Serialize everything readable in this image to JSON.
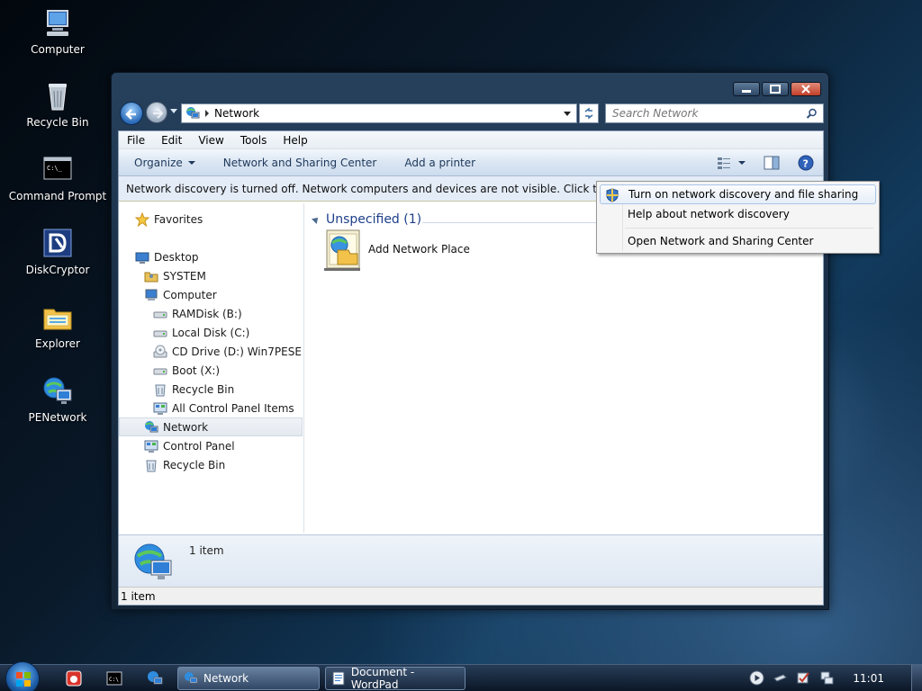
{
  "desktop": {
    "icons": [
      {
        "label": "Computer",
        "icon": "computer-icon"
      },
      {
        "label": "Recycle Bin",
        "icon": "recycle-bin-icon"
      },
      {
        "label": "Command Prompt",
        "icon": "command-prompt-icon"
      },
      {
        "label": "DiskCryptor",
        "icon": "diskcryptor-icon"
      },
      {
        "label": "Explorer",
        "icon": "explorer-icon"
      },
      {
        "label": "PENetwork",
        "icon": "penetwork-icon"
      }
    ]
  },
  "window": {
    "address": {
      "crumb": "Network"
    },
    "search": {
      "placeholder": "Search Network"
    },
    "menu": [
      "File",
      "Edit",
      "View",
      "Tools",
      "Help"
    ],
    "commands": {
      "organize": "Organize",
      "network_center": "Network and Sharing Center",
      "add_printer": "Add a printer"
    },
    "infobar": "Network discovery is turned off. Network computers and devices are not visible. Click to change...",
    "tree": [
      {
        "label": "Favorites",
        "icon": "star-icon"
      },
      {
        "label": "Desktop",
        "icon": "desktop-icon"
      },
      {
        "label": "SYSTEM",
        "icon": "user-folder-icon"
      },
      {
        "label": "Computer",
        "icon": "computer-icon"
      },
      {
        "label": "RAMDisk (B:)",
        "icon": "drive-icon"
      },
      {
        "label": "Local Disk (C:)",
        "icon": "drive-icon"
      },
      {
        "label": "CD Drive (D:) Win7PESE",
        "icon": "cd-drive-icon"
      },
      {
        "label": "Boot (X:)",
        "icon": "drive-icon"
      },
      {
        "label": "Recycle Bin",
        "icon": "recycle-bin-icon"
      },
      {
        "label": "All Control Panel Items",
        "icon": "control-panel-icon"
      },
      {
        "label": "Network",
        "icon": "network-icon"
      },
      {
        "label": "Control Panel",
        "icon": "control-panel-icon"
      },
      {
        "label": "Recycle Bin",
        "icon": "recycle-bin-icon"
      }
    ],
    "group": {
      "title": "Unspecified (1)"
    },
    "items": [
      {
        "label": "Add Network Place",
        "icon": "add-network-place-icon"
      }
    ],
    "details": {
      "count": "1 item"
    },
    "status": {
      "text": "1 item"
    }
  },
  "context_menu": {
    "items": [
      {
        "label": "Turn on network discovery and file sharing",
        "icon": "shield-icon"
      },
      {
        "label": "Help about network discovery"
      },
      {
        "label": "Open Network and Sharing Center"
      }
    ]
  },
  "taskbar": {
    "tasks": [
      {
        "label": "Network",
        "icon": "network-icon"
      },
      {
        "label": "Document - WordPad",
        "icon": "wordpad-icon"
      }
    ],
    "clock": "11:01"
  }
}
